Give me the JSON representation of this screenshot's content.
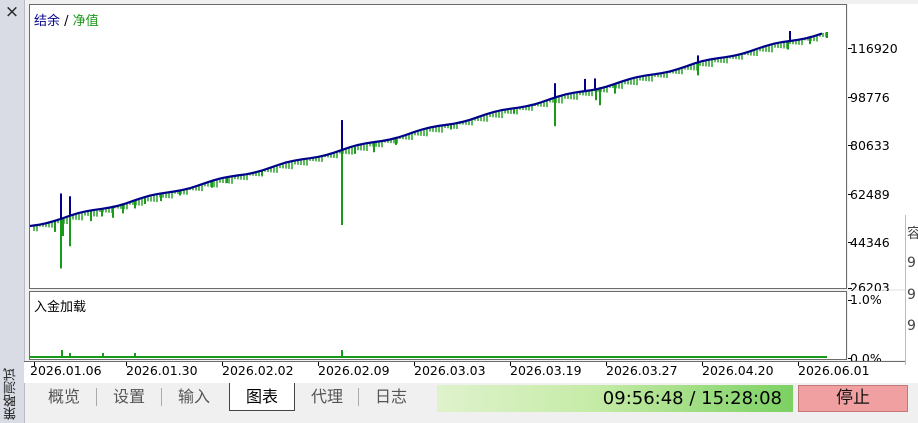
{
  "window": {
    "close_label": "×",
    "panel_title": "策略测试"
  },
  "main_chart": {
    "legend_balance": "结余",
    "legend_sep": " / ",
    "legend_equity": "净值",
    "y_ticks": [
      "116920",
      "98776",
      "80633",
      "62489",
      "44346",
      "26203"
    ],
    "balance_color": "#00008b",
    "equity_color": "#1a9a1a"
  },
  "deposit_chart": {
    "title": "入金加载",
    "y_ticks": [
      "1.0%",
      "0.0%"
    ]
  },
  "x_ticks": [
    "2026.01.06",
    "2026.01.30",
    "2026.02.02",
    "2026.02.09",
    "2026.03.03",
    "2026.03.19",
    "2026.03.27",
    "2026.04.20",
    "2026.06.01"
  ],
  "right_clip": {
    "chars": [
      "容",
      "9",
      "9",
      "9"
    ]
  },
  "tabs": [
    {
      "label": "概览"
    },
    {
      "label": "设置"
    },
    {
      "label": "输入"
    },
    {
      "label": "图表"
    },
    {
      "label": "代理"
    },
    {
      "label": "日志"
    }
  ],
  "active_tab": "图表",
  "progress": {
    "text": "09:56:48 / 15:28:08",
    "fraction": 0.64
  },
  "stop_label": "停止"
}
